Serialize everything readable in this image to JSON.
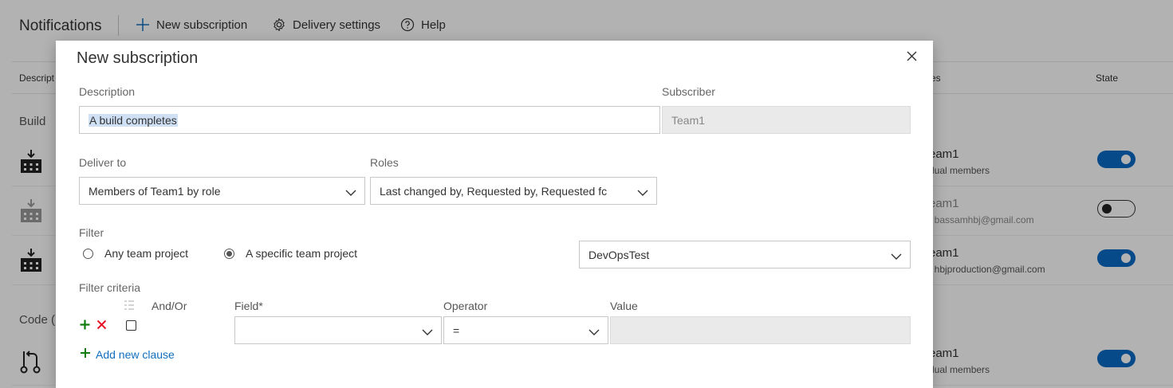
{
  "toolbar": {
    "title": "Notifications",
    "new_subscription": "New subscription",
    "delivery_settings": "Delivery settings",
    "help": "Help"
  },
  "table": {
    "col_description": "Descript",
    "col_subscriber": "es",
    "col_state": "State"
  },
  "groups": {
    "build": "Build",
    "code": "Code ("
  },
  "rows": [
    {
      "name": "eam1",
      "detail": "dual members",
      "state": "on"
    },
    {
      "name": "eam1",
      "detail": ": bassamhbj@gmail.com",
      "state": "off"
    },
    {
      "name": "eam1",
      "detail": ": hbjproduction@gmail.com",
      "state": "on"
    },
    {
      "name": "eam1",
      "detail": "dual members",
      "state": "on"
    }
  ],
  "dialog": {
    "title": "New subscription",
    "description_label": "Description",
    "description_value": "A build completes",
    "subscriber_label": "Subscriber",
    "subscriber_value": "Team1",
    "deliver_to_label": "Deliver to",
    "deliver_to_value": "Members of Team1 by role",
    "roles_label": "Roles",
    "roles_value": "Last changed by, Requested by, Requested fc",
    "filter_label": "Filter",
    "any_project": "Any team project",
    "specific_project": "A specific team project",
    "selected_filter": "specific",
    "project_value": "DevOpsTest",
    "criteria_label": "Filter criteria",
    "and_or_header": "And/Or",
    "field_header": "Field*",
    "operator_header": "Operator",
    "value_header": "Value",
    "field_value": "",
    "operator_value": "=",
    "value_value": "",
    "add_clause": "Add new clause"
  },
  "colors": {
    "accent": "#0a6ac6",
    "add_green": "#107c10",
    "remove_red": "#e81123",
    "link_blue": "#106ebe"
  }
}
